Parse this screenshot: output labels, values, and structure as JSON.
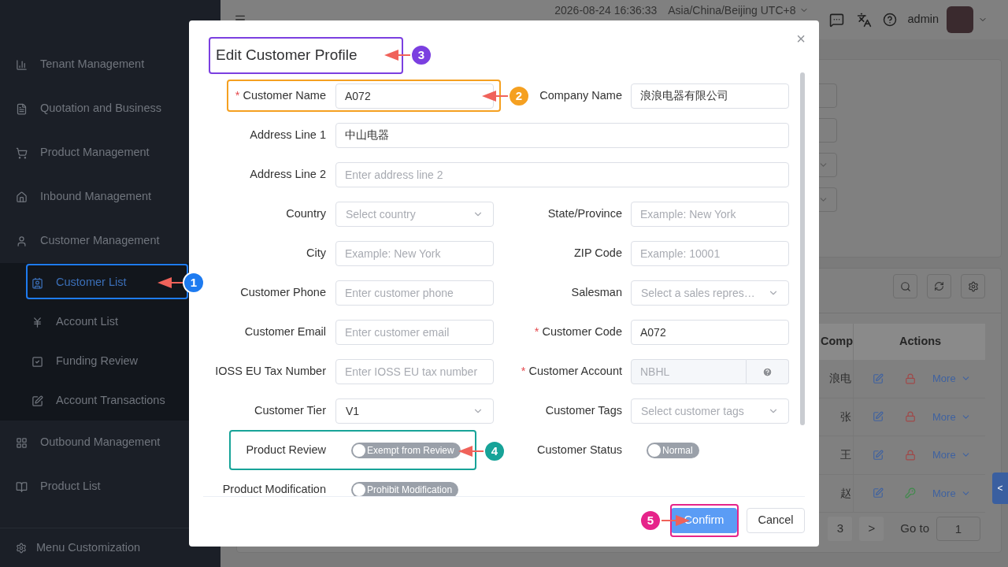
{
  "sidebar": {
    "items": [
      {
        "label": "Tenant Management",
        "selected": false
      },
      {
        "label": "Quotation and Business",
        "selected": false
      },
      {
        "label": "Product Management",
        "selected": false
      },
      {
        "label": "Inbound Management",
        "selected": false
      },
      {
        "label": "Customer Management",
        "selected": false,
        "expanded": true,
        "children": [
          {
            "label": "Customer List",
            "selected": true
          },
          {
            "label": "Account List",
            "selected": false
          },
          {
            "label": "Funding Review",
            "selected": false
          },
          {
            "label": "Account Transactions",
            "selected": false
          }
        ]
      },
      {
        "label": "Outbound Management",
        "selected": false
      },
      {
        "label": "Product List",
        "selected": false
      }
    ],
    "footer": "Menu Customization"
  },
  "header": {
    "time": "2026-08-24 16:36:33",
    "timezone": "Asia/China/Beijing UTC+8",
    "user": "admin"
  },
  "filters": [
    {
      "kind": "input"
    },
    {
      "kind": "input"
    },
    {
      "kind": "select"
    },
    {
      "kind": "select"
    }
  ],
  "table": {
    "columns": [
      "Comp",
      "Actions"
    ],
    "rows": [
      {
        "company": "浪电",
        "locked": true,
        "more": "More"
      },
      {
        "company": "张",
        "locked": true,
        "more": "More"
      },
      {
        "company": "王",
        "locked": true,
        "more": "More"
      },
      {
        "company": "赵",
        "locked": false,
        "more": "More"
      }
    ]
  },
  "pagination": {
    "pages": [
      {
        "label": "3",
        "selected": false
      }
    ],
    "next": ">",
    "goto_label": "Go to",
    "goto_value": "1"
  },
  "side_tab": "<",
  "dialog": {
    "title": "Edit Customer Profile",
    "close": "×",
    "required_mark": "*",
    "rows": [
      [
        {
          "kind": "input",
          "label": "Customer Name",
          "required": true,
          "value": "A072"
        },
        {
          "kind": "input",
          "label": "Company Name",
          "required": false,
          "value": "浪浪电器有限公司"
        }
      ],
      [
        {
          "kind": "input",
          "label": "Address Line 1",
          "required": false,
          "value": "中山电器"
        }
      ],
      [
        {
          "kind": "input",
          "label": "Address Line 2",
          "required": false,
          "placeholder": "Enter address line 2"
        }
      ],
      [
        {
          "kind": "select",
          "label": "Country",
          "required": false,
          "placeholder": "Select country"
        },
        {
          "kind": "input",
          "label": "State/Province",
          "required": false,
          "placeholder": "Example: New York"
        }
      ],
      [
        {
          "kind": "input",
          "label": "City",
          "required": false,
          "placeholder": "Example: New York"
        },
        {
          "kind": "input",
          "label": "ZIP Code",
          "required": false,
          "placeholder": "Example: 10001"
        }
      ],
      [
        {
          "kind": "input",
          "label": "Customer Phone",
          "required": false,
          "placeholder": "Enter customer phone"
        },
        {
          "kind": "select",
          "label": "Salesman",
          "required": false,
          "placeholder": "Select a sales repres…"
        }
      ],
      [
        {
          "kind": "input",
          "label": "Customer Email",
          "required": false,
          "placeholder": "Enter customer email"
        },
        {
          "kind": "input",
          "label": "Customer Code",
          "required": true,
          "value": "A072"
        }
      ],
      [
        {
          "kind": "input",
          "label": "IOSS EU Tax Number",
          "required": false,
          "placeholder": "Enter IOSS EU tax number"
        },
        {
          "kind": "account",
          "label": "Customer Account",
          "required": true,
          "value": "NBHL",
          "disabled": true
        }
      ],
      [
        {
          "kind": "select",
          "label": "Customer Tier",
          "required": false,
          "value": "V1"
        },
        {
          "kind": "select",
          "label": "Customer Tags",
          "required": false,
          "placeholder": "Select customer tags"
        }
      ],
      [
        {
          "kind": "switch",
          "label": "Product Review",
          "required": false,
          "on": false,
          "text": "Exempt from Review"
        },
        {
          "kind": "switch",
          "label": "Customer Status",
          "required": false,
          "on": false,
          "text": "Normal"
        }
      ],
      [
        {
          "kind": "switch",
          "label": "Product Modification",
          "required": false,
          "on": false,
          "text": "Prohibit Modification"
        }
      ]
    ],
    "buttons": [
      {
        "label": "Confirm",
        "primary": true
      },
      {
        "label": "Cancel",
        "primary": false
      }
    ]
  },
  "annotations": [
    {
      "number": "1",
      "color": "#1e7bf0"
    },
    {
      "number": "2",
      "color": "#f5a020"
    },
    {
      "number": "3",
      "color": "#7b3fe0"
    },
    {
      "number": "4",
      "color": "#17a398"
    },
    {
      "number": "5",
      "color": "#e6248a"
    }
  ]
}
